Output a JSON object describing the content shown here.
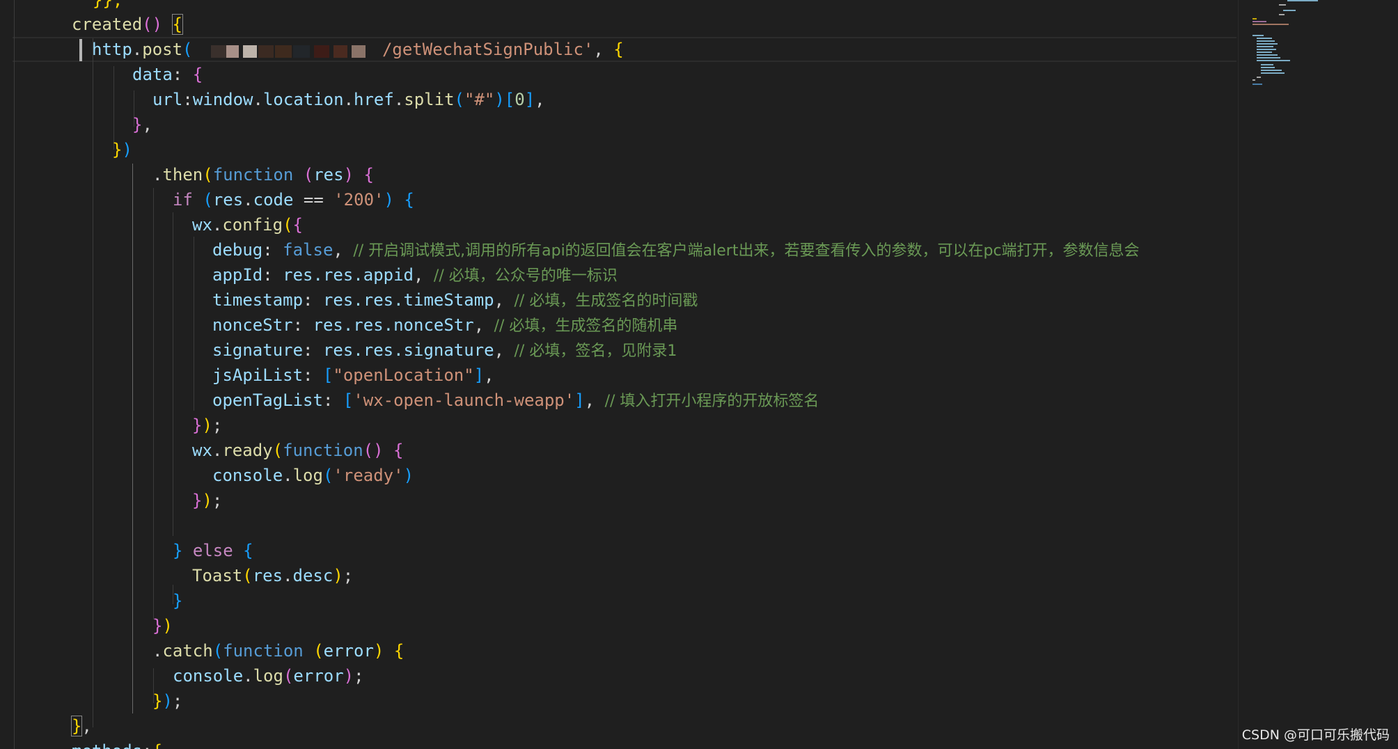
{
  "editor": {
    "theme_colors": {
      "background": "#1f1f1f",
      "keyword": "#569cd6",
      "control_keyword": "#c586c0",
      "function": "#dcdcaa",
      "variable": "#9cdcfe",
      "string": "#ce9178",
      "number": "#b5cea8",
      "comment": "#6a9955"
    },
    "code": {
      "l0_end": "}},",
      "l1_created": "created",
      "l2_http": "http",
      "l2_post": "post",
      "l2_url_suffix": "/getWechatSignPublic'",
      "l3_data": "data",
      "l4_url": "url",
      "l4_window": "window",
      "l4_location": "location",
      "l4_href": "href",
      "l4_split": "split",
      "l4_hash": "\"#\"",
      "l4_index": "0",
      "l7_then": "then",
      "l7_function": "function",
      "l7_res": "res",
      "l8_if": "if",
      "l8_res": "res",
      "l8_code": "code",
      "l8_eq": " == ",
      "l8_str": "'200'",
      "l9_wx": "wx",
      "l9_config": "config",
      "l10_debug": "debug",
      "l10_false": "false",
      "l10_comment": "// 开启调试模式,调用的所有api的返回值会在客户端alert出来，若要查看传入的参数，可以在pc端打开，参数信息会",
      "l11_key": "appId",
      "l11_val": "res.res.appid",
      "l11_comment": "// 必填，公众号的唯一标识",
      "l12_key": "timestamp",
      "l12_val": "res.res.timeStamp",
      "l12_comment": "// 必填，生成签名的时间戳",
      "l13_key": "nonceStr",
      "l13_val": "res.res.nonceStr",
      "l13_comment": "// 必填，生成签名的随机串",
      "l14_key": "signature",
      "l14_val": "res.res.signature",
      "l14_comment": "// 必填，签名，见附录1",
      "l15_key": "jsApiList",
      "l15_str": "\"openLocation\"",
      "l16_key": "openTagList",
      "l16_str": "'wx-open-launch-weapp'",
      "l16_comment": "// 填入打开小程序的开放标签名",
      "l18_wx": "wx",
      "l18_ready": "ready",
      "l18_function": "function",
      "l19_console": "console",
      "l19_log": "log",
      "l19_str": "'ready'",
      "l22_else": "else",
      "l23_toast": "Toast",
      "l23_res": "res",
      "l23_desc": "desc",
      "l26_catch": "catch",
      "l26_function": "function",
      "l26_error": "error",
      "l27_console": "console",
      "l27_log": "log",
      "l27_error": "error",
      "l30_methods": "methods"
    }
  },
  "minimap": {
    "mascot_icon": "anime-witch-mascot"
  },
  "watermark": {
    "text": "CSDN @可口可乐搬代码"
  }
}
